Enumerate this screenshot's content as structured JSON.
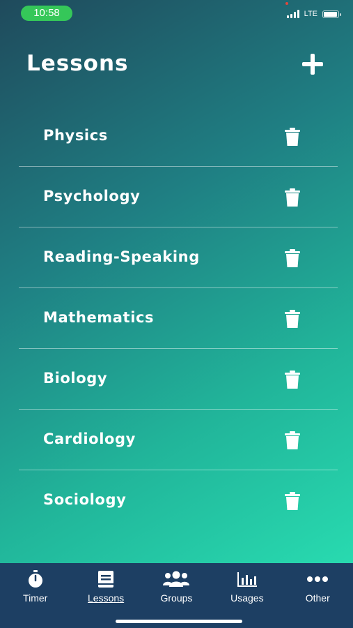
{
  "status": {
    "time": "10:58",
    "network": "LTE",
    "battery_level": 0.95,
    "signal_bars": 4
  },
  "header": {
    "title": "Lessons",
    "add_icon": "plus-icon"
  },
  "lessons": [
    {
      "name": "Physics",
      "action_icon": "trash-icon"
    },
    {
      "name": "Psychology",
      "action_icon": "trash-icon"
    },
    {
      "name": "Reading-Speaking",
      "action_icon": "trash-icon"
    },
    {
      "name": "Mathematics",
      "action_icon": "trash-icon"
    },
    {
      "name": "Biology",
      "action_icon": "trash-icon"
    },
    {
      "name": "Cardiology",
      "action_icon": "trash-icon"
    },
    {
      "name": "Sociology",
      "action_icon": "trash-icon"
    }
  ],
  "tabbar": {
    "tabs": [
      {
        "label": "Timer",
        "icon": "stopwatch-icon"
      },
      {
        "label": "Lessons",
        "icon": "book-icon",
        "active": true
      },
      {
        "label": "Groups",
        "icon": "people-icon"
      },
      {
        "label": "Usages",
        "icon": "bar-chart-icon"
      },
      {
        "label": "Other",
        "icon": "ellipsis-icon"
      }
    ]
  },
  "colors": {
    "gradient_start": "#1f4a5c",
    "gradient_end": "#2ae5b6",
    "tabbar": "#1d3f63",
    "time_pill": "#35c759"
  }
}
